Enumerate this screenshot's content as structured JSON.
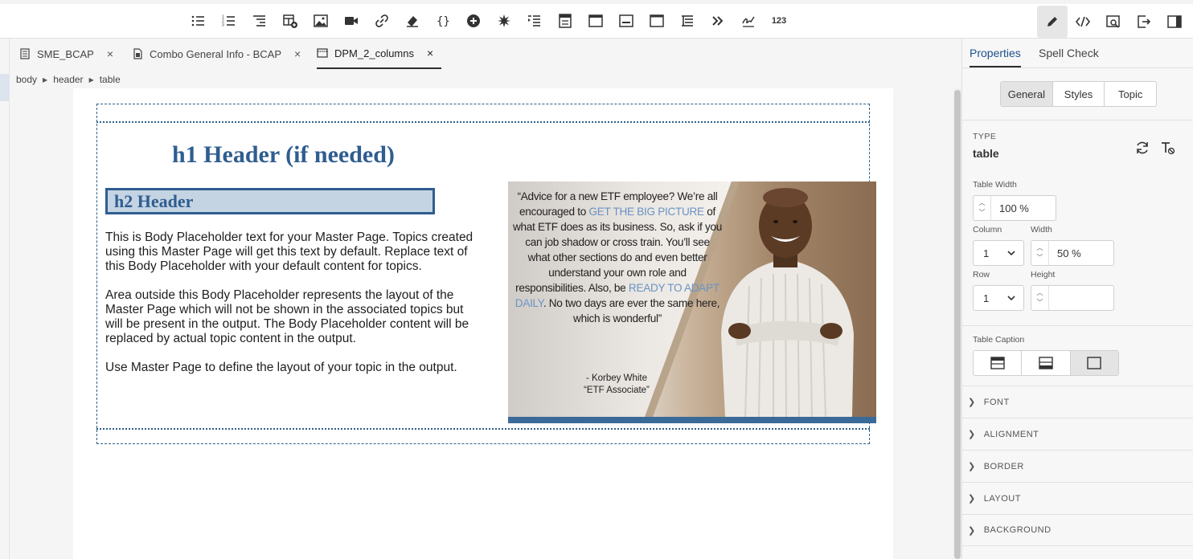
{
  "toolbar": {
    "icons": [
      "bulleted-list",
      "numbered-list",
      "multilevel-list",
      "insert-table",
      "insert-image",
      "insert-video",
      "insert-link",
      "insert-snippet",
      "insert-code",
      "insert-symbol",
      "insert-special",
      "insert-indent",
      "insert-block",
      "insert-layout-top",
      "insert-layout-bottom",
      "insert-layout-side",
      "insert-toc",
      "more",
      "signature"
    ],
    "number_label": "123",
    "right_icons": [
      "edit",
      "source",
      "preview",
      "export",
      "panel-toggle"
    ]
  },
  "tabs": [
    {
      "label": "SME_BCAP",
      "close": "×"
    },
    {
      "label": "Combo General Info - BCAP",
      "close": "×"
    },
    {
      "label": "DPM_2_columns",
      "close": "×"
    }
  ],
  "breadcrumb": [
    "body",
    "header",
    "table"
  ],
  "document": {
    "h1": "h1 Header (if needed)",
    "h2": "h2 Header",
    "paragraphs": [
      "This is Body Placeholder text for your Master Page. Topics created using this Master Page will get this text by default. Replace text of this Body Placeholder with your default content for topics.",
      "Area outside this Body Placeholder represents the layout of the Master Page which will not be shown in the associated topics but will be present in the output. The Body Placeholder content will be replaced by actual topic content in the output.",
      "Use Master Page to define the layout of your topic in the output."
    ],
    "image": {
      "quote_1": "“Advice for a new ETF employee? We’re all encouraged to ",
      "quote_hl1": "GET THE BIG PICTURE",
      "quote_2": " of what ETF does as its business. So, ask if you can job shadow or cross train. You’ll see what other sections do and even better understand your own role and responsibilities. Also, be ",
      "quote_hl2": "READY TO ADAPT DAILY",
      "quote_3": ". No two days are ever the same here, which is wonderful”",
      "sig_name": "- Korbey White",
      "sig_title": "“ETF Associate”"
    }
  },
  "panel": {
    "tabs": [
      "Properties",
      "Spell Check"
    ],
    "segments": [
      "General",
      "Styles",
      "Topic"
    ],
    "type_label": "TYPE",
    "type_value": "table",
    "table_width_label": "Table Width",
    "table_width_value": "100 %",
    "column_label": "Column",
    "column_value": "1",
    "width_label": "Width",
    "width_value": "50 %",
    "row_label": "Row",
    "row_value": "1",
    "height_label": "Height",
    "height_value": "",
    "caption_label": "Table Caption",
    "sections": [
      "FONT",
      "ALIGNMENT",
      "BORDER",
      "LAYOUT",
      "BACKGROUND"
    ]
  }
}
